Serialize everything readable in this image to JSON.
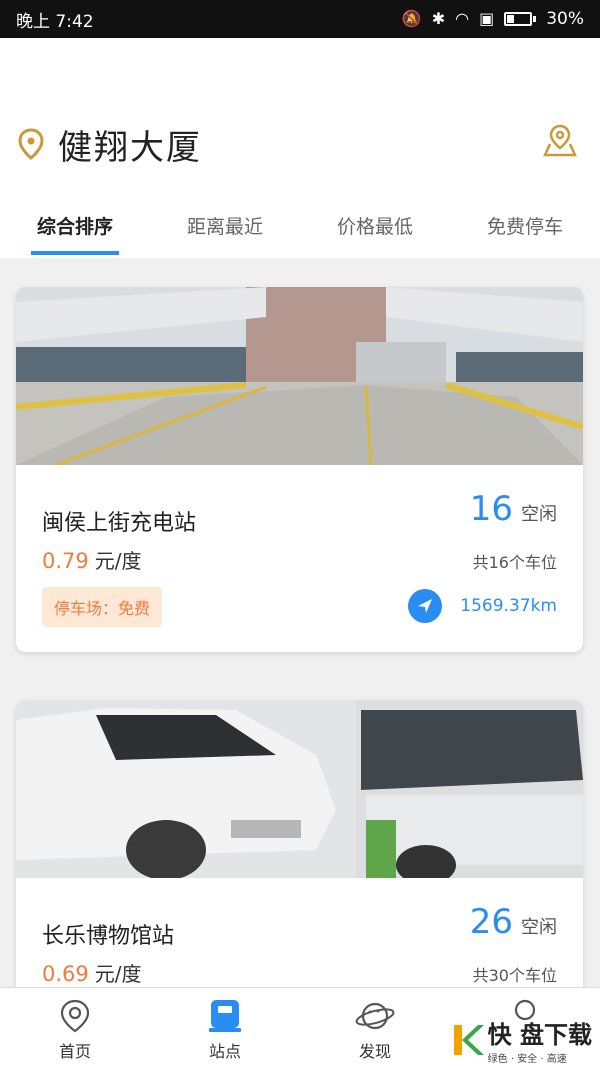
{
  "status_bar": {
    "time": "晚上 7:42",
    "battery_text": "30%",
    "battery_level": 0.3
  },
  "header": {
    "location_title": "健翔大厦",
    "icons": {
      "location": "location-pin-icon",
      "map": "map-pin-icon"
    }
  },
  "tabs": [
    {
      "label": "综合排序",
      "active": true
    },
    {
      "label": "距离最近",
      "active": false
    },
    {
      "label": "价格最低",
      "active": false
    },
    {
      "label": "免费停车",
      "active": false
    }
  ],
  "stations": [
    {
      "name": "闽侯上街充电站",
      "price": "0.79",
      "unit": "元/度",
      "free_count": "16",
      "free_label": "空闲",
      "total": "共16个车位",
      "parking_tag": "停车场：免费",
      "distance": "1569.37km"
    },
    {
      "name": "长乐博物馆站",
      "price": "0.69",
      "unit": "元/度",
      "free_count": "26",
      "free_label": "空闲",
      "total": "共30个车位"
    }
  ],
  "bottom_nav": [
    {
      "label": "首页",
      "icon": "home-pin-icon",
      "active": false
    },
    {
      "label": "站点",
      "icon": "station-icon",
      "active": true
    },
    {
      "label": "发现",
      "icon": "planet-icon",
      "active": false
    },
    {
      "label": "",
      "icon": "profile-icon",
      "active": false
    }
  ],
  "watermark": {
    "main": "快 盘下载",
    "sub": "绿色 · 安全 · 高速"
  },
  "colors": {
    "accent": "#2a8df1",
    "price": "#f07b3f",
    "gold": "#c89a3a"
  }
}
